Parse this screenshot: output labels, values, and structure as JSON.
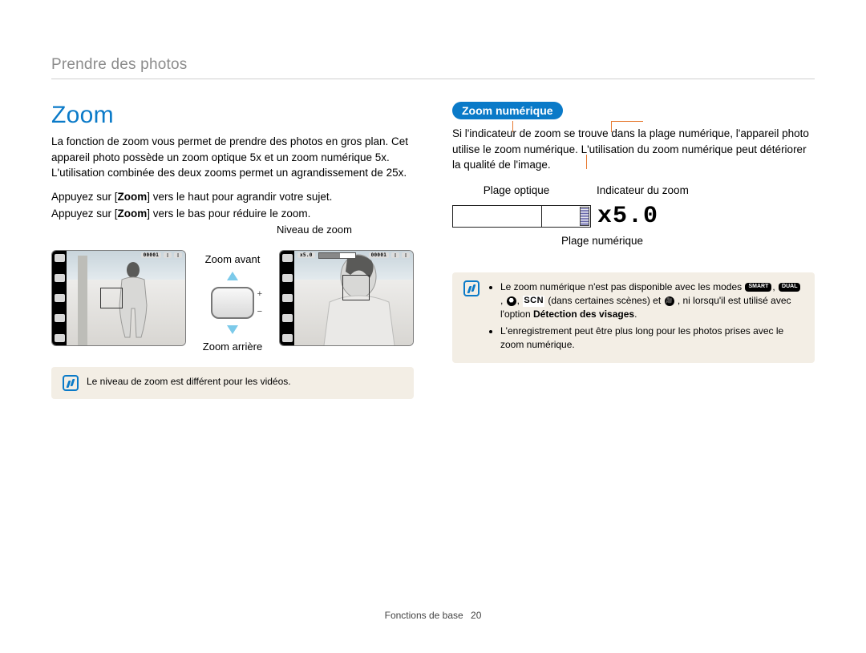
{
  "header": {
    "breadcrumb": "Prendre des photos"
  },
  "left": {
    "title": "Zoom",
    "intro": "La fonction de zoom vous permet de prendre des photos en gros plan. Cet appareil photo possède un zoom optique 5x et un zoom numérique 5x. L'utilisation combinée des deux zooms permet un agrandissement de 25x.",
    "instr1_pre": "Appuyez sur [",
    "instr1_btn": "Zoom",
    "instr1_post": "] vers le haut pour agrandir votre sujet.",
    "instr2_pre": "Appuyez sur [",
    "instr2_btn": "Zoom",
    "instr2_post": "] vers le bas pour réduire le zoom.",
    "niveau_label": "Niveau de zoom",
    "zoom_in_label": "Zoom avant",
    "zoom_out_label": "Zoom arrière",
    "lcd_counter": "00001",
    "lcd_zoomvalue": "x5.0",
    "note1": "Le niveau de zoom est différent pour les vidéos."
  },
  "right": {
    "pill": "Zoom numérique",
    "body": "Si l'indicateur de zoom se trouve dans la plage numérique, l'appareil photo utilise le zoom numérique. L'utilisation du zoom numérique peut détériorer la qualité de l'image.",
    "label_optique": "Plage optique",
    "label_indicateur": "Indicateur du zoom",
    "label_numerique": "Plage numérique",
    "zoom_value": "x5.0",
    "note_items": [
      {
        "pre": "Le zoom numérique n'est pas disponible avec les modes ",
        "mid": " (dans certaines scènes) et ",
        "post": ", ni lorsqu'il est utilisé avec l'option ",
        "bold": "Détection des visages",
        "tail": "."
      },
      {
        "text": "L'enregistrement peut être plus long pour les photos prises avec le zoom numérique."
      }
    ],
    "icons": {
      "smart": "SMART",
      "dual": "DUAL",
      "scn": "SCN"
    }
  },
  "footer": {
    "section": "Fonctions de base",
    "page": "20"
  }
}
